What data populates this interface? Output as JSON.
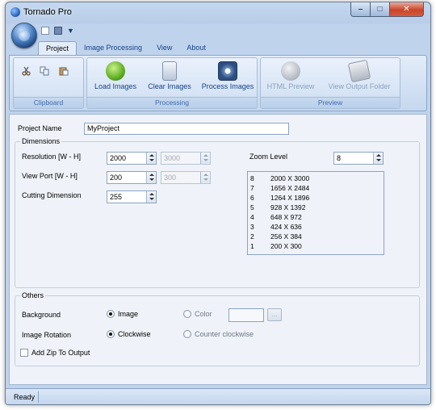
{
  "window": {
    "title": "Tornado Pro"
  },
  "ribbon": {
    "tabs": [
      "Project",
      "Image Processing",
      "View",
      "About"
    ],
    "groups": {
      "clipboard": "Clipboard",
      "processing": "Processing",
      "preview": "Preview"
    },
    "buttons": {
      "load_images": "Load Images",
      "clear_images": "Clear Images",
      "process_images": "Process Images",
      "html_preview": "HTML Preview",
      "view_output_folder": "View Output Folder"
    }
  },
  "project": {
    "name_label": "Project Name",
    "name_value": "MyProject"
  },
  "dimensions": {
    "legend": "Dimensions",
    "resolution_label": "Resolution [W - H]",
    "resolution_w": "2000",
    "resolution_h": "3000",
    "viewport_label": "View Port [W - H]",
    "viewport_w": "200",
    "viewport_h": "300",
    "cutting_label": "Cutting Dimension",
    "cutting_value": "255",
    "zoom_label": "Zoom Level",
    "zoom_value": "8",
    "zoom_levels": [
      {
        "level": "8",
        "size": "2000 X 3000"
      },
      {
        "level": "7",
        "size": "1656 X 2484"
      },
      {
        "level": "6",
        "size": "1264 X 1896"
      },
      {
        "level": "5",
        "size": "928 X 1392"
      },
      {
        "level": "4",
        "size": "648 X 972"
      },
      {
        "level": "3",
        "size": "424 X 636"
      },
      {
        "level": "2",
        "size": "256 X 384"
      },
      {
        "level": "1",
        "size": "200 X 300"
      }
    ]
  },
  "others": {
    "legend": "Others",
    "background_label": "Background",
    "background_image": "Image",
    "background_color": "Color",
    "ellipsis": "...",
    "rotation_label": "Image Rotation",
    "rotation_cw": "Clockwise",
    "rotation_ccw": "Counter clockwise",
    "zip_label": "Add Zip To Output"
  },
  "status": {
    "text": "Ready"
  }
}
